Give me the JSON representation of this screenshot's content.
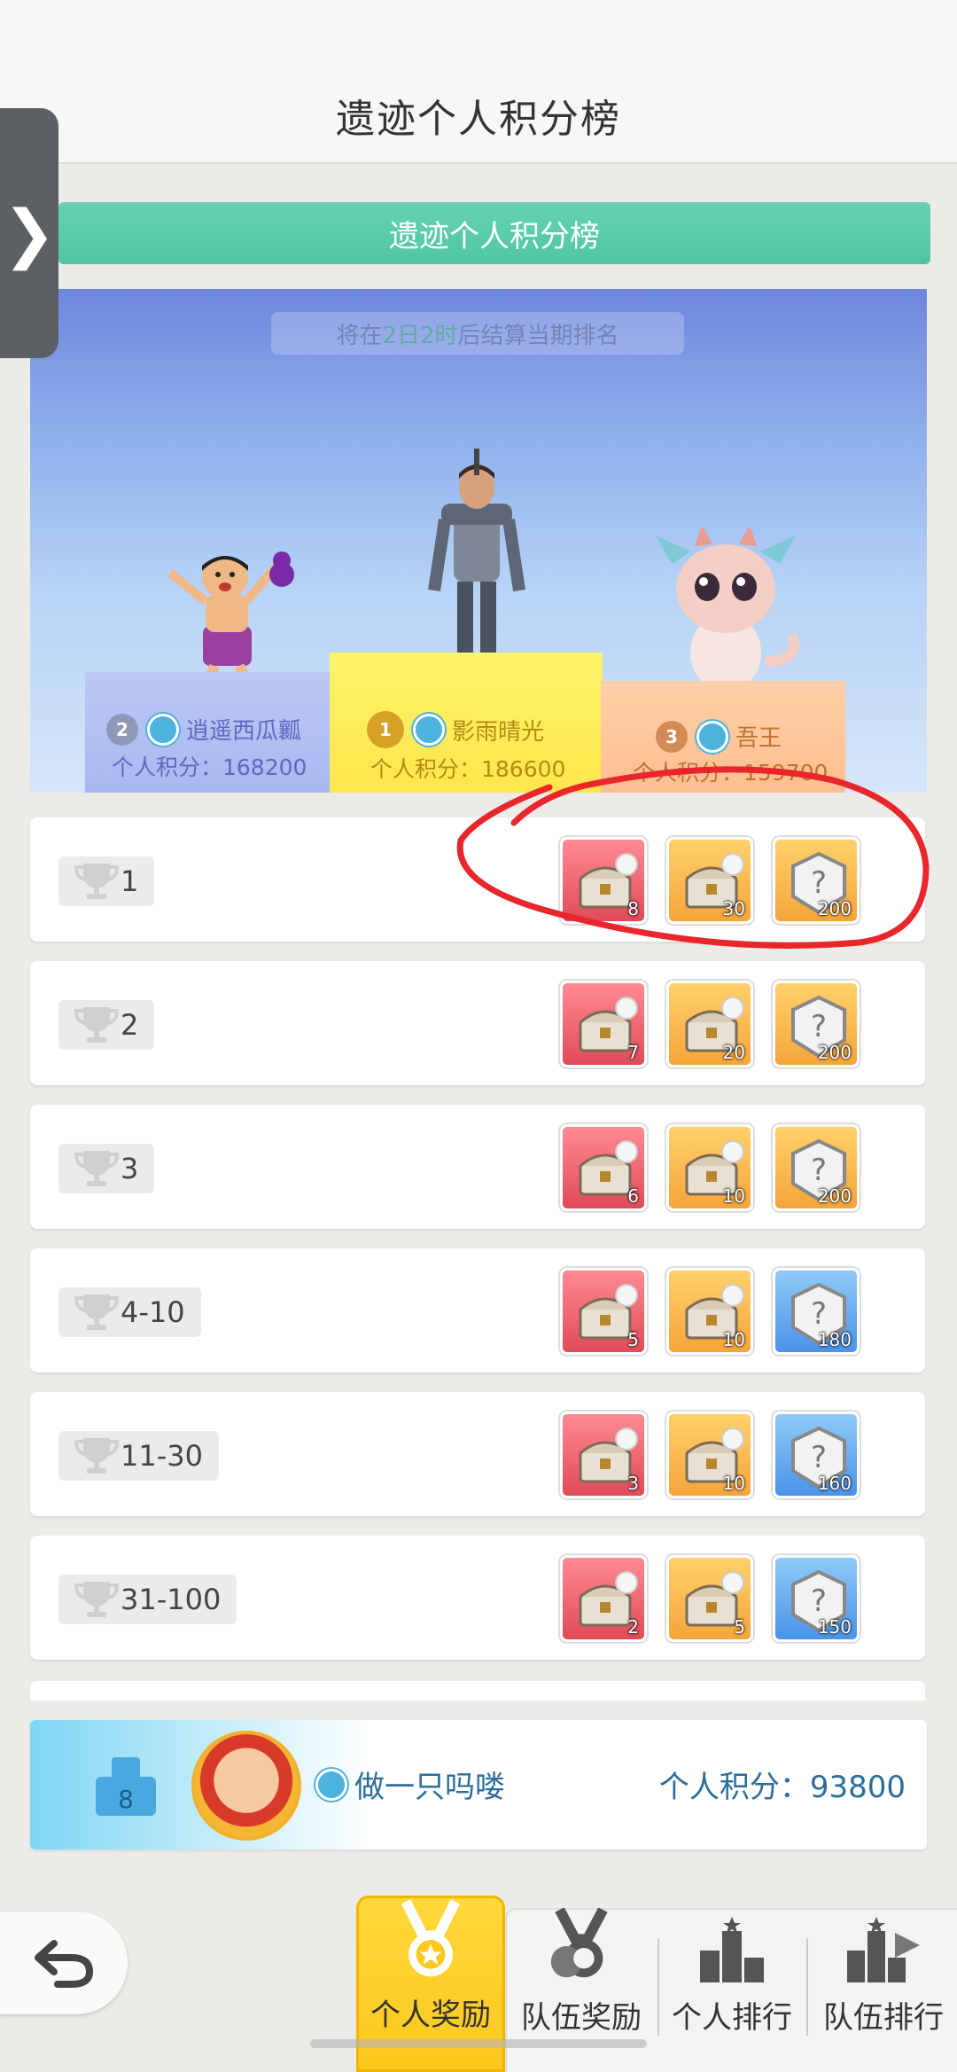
{
  "header": {
    "title": "遗迹个人积分榜",
    "side_tab_glyph": "❯"
  },
  "banner": {
    "label": "遗迹个人积分榜"
  },
  "podium": {
    "countdown": {
      "prefix": "将在",
      "days": "2日",
      "hours": "2时",
      "suffix": "后结算当期排名"
    },
    "first": {
      "rank": "1",
      "name": "影雨晴光",
      "score": "个人积分：186600"
    },
    "second": {
      "rank": "2",
      "name": "逍遥西瓜瓤",
      "score": "个人积分：168200"
    },
    "third": {
      "rank": "3",
      "name": "吾王",
      "score": "个人积分：159700"
    }
  },
  "rewards": [
    {
      "rank": "1",
      "items": [
        {
          "color": "red",
          "count": "8"
        },
        {
          "color": "orange",
          "count": "30"
        },
        {
          "color": "orange",
          "count": "200"
        }
      ]
    },
    {
      "rank": "2",
      "items": [
        {
          "color": "red",
          "count": "7"
        },
        {
          "color": "orange",
          "count": "20"
        },
        {
          "color": "orange",
          "count": "200"
        }
      ]
    },
    {
      "rank": "3",
      "items": [
        {
          "color": "red",
          "count": "6"
        },
        {
          "color": "orange",
          "count": "10"
        },
        {
          "color": "orange",
          "count": "200"
        }
      ]
    },
    {
      "rank": "4-10",
      "items": [
        {
          "color": "red",
          "count": "5"
        },
        {
          "color": "orange",
          "count": "10"
        },
        {
          "color": "blue",
          "count": "180"
        }
      ]
    },
    {
      "rank": "11-30",
      "items": [
        {
          "color": "red",
          "count": "3"
        },
        {
          "color": "orange",
          "count": "10"
        },
        {
          "color": "blue",
          "count": "160"
        }
      ]
    },
    {
      "rank": "31-100",
      "items": [
        {
          "color": "red",
          "count": "2"
        },
        {
          "color": "orange",
          "count": "5"
        },
        {
          "color": "blue",
          "count": "150"
        }
      ]
    }
  ],
  "me": {
    "rank": "8",
    "name": "做一只吗喽",
    "score": "个人积分：93800"
  },
  "nav": {
    "items": [
      {
        "label": "个人奖励",
        "active": true,
        "icon": "medal-icon"
      },
      {
        "label": "队伍奖励",
        "active": false,
        "icon": "team-medal-icon"
      },
      {
        "label": "个人排行",
        "active": false,
        "icon": "podium-icon"
      },
      {
        "label": "队伍排行",
        "active": false,
        "icon": "team-podium-icon"
      }
    ]
  },
  "colors": {
    "accent_green": "#4fc5a4",
    "active_tab": "#ffc81e",
    "annotation": "#e8262b",
    "score_text": "#2b6e99"
  }
}
